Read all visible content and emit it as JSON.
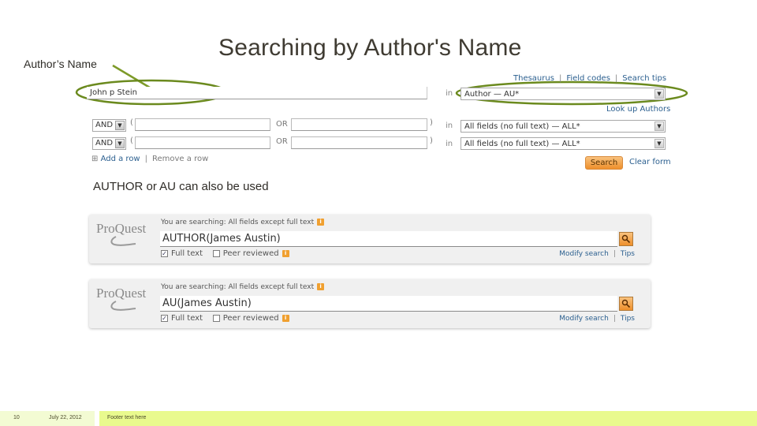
{
  "slide": {
    "title": "Searching by Author's Name",
    "callout_label": "Author’s Name",
    "caption": "AUTHOR or AU can also be used",
    "accent_color": "#6b8a1e"
  },
  "advanced_search": {
    "top_links": [
      "Thesaurus",
      "Field codes",
      "Search tips"
    ],
    "row1": {
      "query": "John p Stein",
      "in_label": "in",
      "field": "Author — AU*"
    },
    "lookup_link": "Look up Authors",
    "rows": [
      {
        "operator": "AND",
        "left_value": "",
        "or_label": "OR",
        "right_value": "",
        "in_label": "in",
        "field": "All fields (no full text) — ALL*"
      },
      {
        "operator": "AND",
        "left_value": "",
        "or_label": "OR",
        "right_value": "",
        "in_label": "in",
        "field": "All fields (no full text) — ALL*"
      }
    ],
    "add_row": "Add a row",
    "remove_row": "Remove a row",
    "search_button": "Search",
    "clear_form": "Clear form"
  },
  "proquest_boxes": [
    {
      "logo": "ProQuest",
      "scope": "You are searching: All fields except full text",
      "query": "AUTHOR(James Austin)",
      "full_text_label": "Full text",
      "full_text_checked": true,
      "peer_reviewed_label": "Peer reviewed",
      "peer_reviewed_checked": false,
      "modify_search": "Modify search",
      "tips": "Tips"
    },
    {
      "logo": "ProQuest",
      "scope": "You are searching: All fields except full text",
      "query": "AU(James Austin)",
      "full_text_label": "Full text",
      "full_text_checked": true,
      "peer_reviewed_label": "Peer reviewed",
      "peer_reviewed_checked": false,
      "modify_search": "Modify search",
      "tips": "Tips"
    }
  ],
  "footer": {
    "page_number": "10",
    "date": "July 22, 2012",
    "text": "Footer text here"
  }
}
